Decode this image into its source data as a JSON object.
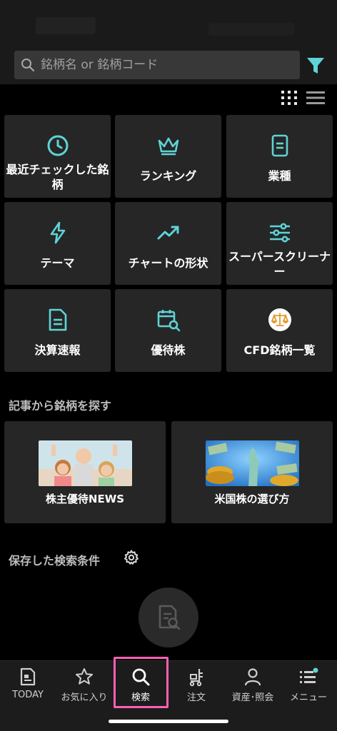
{
  "search": {
    "placeholder": "銘柄名 or 銘柄コード"
  },
  "menu_tiles": [
    {
      "label": "最近チェックした銘柄",
      "icon": "clock-icon"
    },
    {
      "label": "ランキング",
      "icon": "crown-icon"
    },
    {
      "label": "業種",
      "icon": "document-icon"
    },
    {
      "label": "テーマ",
      "icon": "lightning-icon"
    },
    {
      "label": "チャートの形状",
      "icon": "trend-up-icon"
    },
    {
      "label": "スーパースクリーナー",
      "icon": "sliders-icon"
    },
    {
      "label": "決算速報",
      "icon": "report-icon"
    },
    {
      "label": "優待株",
      "icon": "calendar-search-icon"
    },
    {
      "label": "CFD銘柄一覧",
      "icon": "scales-icon"
    }
  ],
  "articles_section": {
    "title": "記事から銘柄を探す",
    "items": [
      {
        "label": "株主優待NEWS"
      },
      {
        "label": "米国株の選び方"
      }
    ]
  },
  "saved_section": {
    "title": "保存した検索条件"
  },
  "tabs": [
    {
      "label": "TODAY",
      "icon": "newspaper-icon",
      "active": false
    },
    {
      "label": "お気に入り",
      "icon": "star-icon",
      "active": false
    },
    {
      "label": "検索",
      "icon": "search-icon",
      "active": true
    },
    {
      "label": "注文",
      "icon": "cart-icon",
      "active": false
    },
    {
      "label": "資産･照会",
      "icon": "person-icon",
      "active": false
    },
    {
      "label": "メニュー",
      "icon": "menu-icon",
      "active": false
    }
  ],
  "colors": {
    "accent": "#5fd3d6",
    "highlight": "#ff5fb4",
    "tile_bg": "#262626",
    "background": "#000000"
  }
}
